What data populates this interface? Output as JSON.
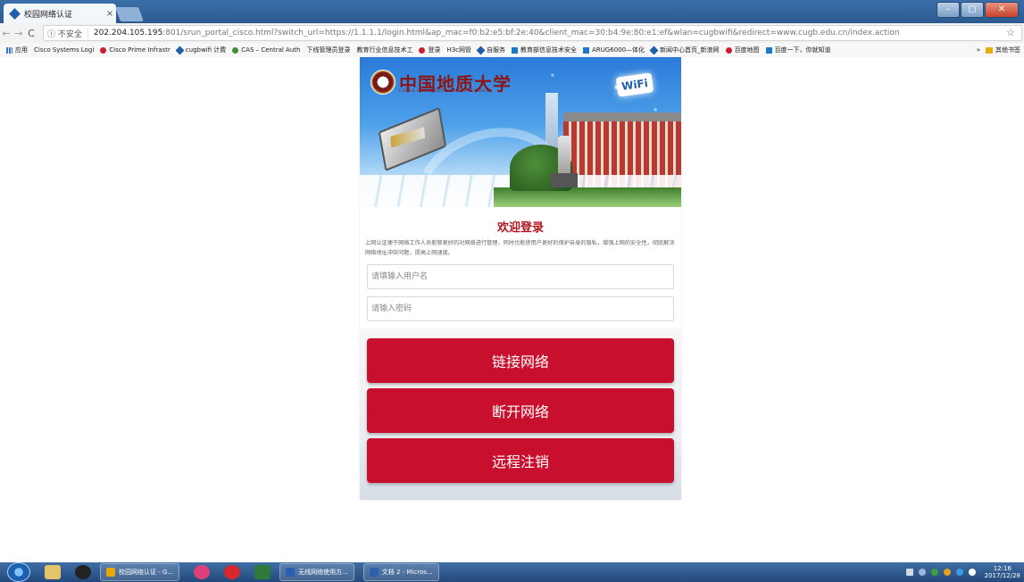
{
  "browser": {
    "tab_title": "校园网络认证",
    "tab_close": "×",
    "nav": {
      "back": "←",
      "forward": "→",
      "reload": "C"
    },
    "url": {
      "secure_label": "ⓘ 不安全",
      "host": "202.204.105.195",
      "path": ":801/srun_portal_cisco.html?switch_url=https://1.1.1.1/login.html&ap_mac=f0:b2:e5:bf:2e:40&client_mac=30:b4:9e:80:e1:ef&wlan=cugbwifi&redirect=www.cugb.edu.cn/index.action"
    },
    "star": "☆",
    "bookmarks": [
      {
        "label": "应用",
        "icon": "grid"
      },
      {
        "label": "Cisco Systems Logi",
        "icon": "page"
      },
      {
        "label": "Cisco Prime Infrastr",
        "icon": "red"
      },
      {
        "label": "cugbwifi 计费",
        "icon": "blue"
      },
      {
        "label": "CAS – Central Auth",
        "icon": "green"
      },
      {
        "label": "下线管理员登录",
        "icon": "page"
      },
      {
        "label": "教育行业信息技术工",
        "icon": "page"
      },
      {
        "label": "登录",
        "icon": "red"
      },
      {
        "label": "H3c网管",
        "icon": "page"
      },
      {
        "label": "自服务",
        "icon": "blue"
      },
      {
        "label": "教育部信息技术安全",
        "icon": "azure"
      },
      {
        "label": "ARUG6000—体化",
        "icon": "azure"
      },
      {
        "label": "新闻中心首页_新浪网",
        "icon": "blue"
      },
      {
        "label": "百度地图",
        "icon": "red"
      },
      {
        "label": "百度一下，你就知道",
        "icon": "azure"
      }
    ],
    "bookmarks_more": "»",
    "bookmarks_other": "其他书签"
  },
  "banner": {
    "logo_cn": "中国地质大学",
    "logo_en": "CHINA UNIVERSITY OF GEOSCIENCES",
    "wifi_badge": "WiFi"
  },
  "login": {
    "welcome": "欢迎登录",
    "description": "上网认证便于网络工作人员能够更好的对网络进行管理，同时也能使用户更好的保护自身的隐私，增强上网的安全性，彻底解决网络地址冲突问题，提高上网速度。",
    "username_placeholder": "请填输入用户名",
    "password_placeholder": "请输入密码",
    "connect_label": "链接网络",
    "disconnect_label": "断开网络",
    "logout_label": "远程注销",
    "accent_color": "#c8102e"
  },
  "taskbar": {
    "tasks": [
      {
        "label": "校园网络认证 - G...",
        "icon_color": "#e8a800"
      },
      {
        "label": "无线网络使用方...",
        "icon_color": "#2b5fb0"
      },
      {
        "label": "文档 2 - Micros...",
        "icon_color": "#2b5fb0"
      }
    ],
    "clock_time": "12:16",
    "clock_date": "2017/12/28"
  }
}
